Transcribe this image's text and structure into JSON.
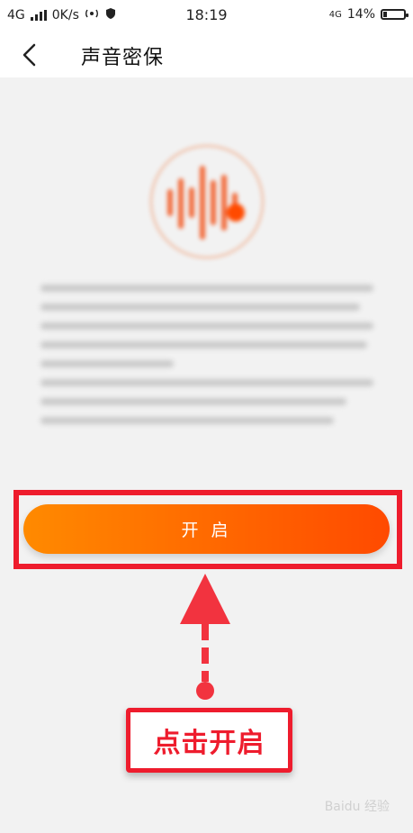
{
  "status": {
    "network": "4G",
    "speed": "0K/s",
    "time": "18:19",
    "network_right": "4G",
    "battery": "14%"
  },
  "nav": {
    "title": "声音密保"
  },
  "main": {
    "button_label": "开 启",
    "annotation": "点击开启",
    "watermark": "Baidu 经验"
  },
  "colors": {
    "accent_start": "#ff8a00",
    "accent_end": "#ff4a00",
    "highlight": "#ee1c2d"
  }
}
